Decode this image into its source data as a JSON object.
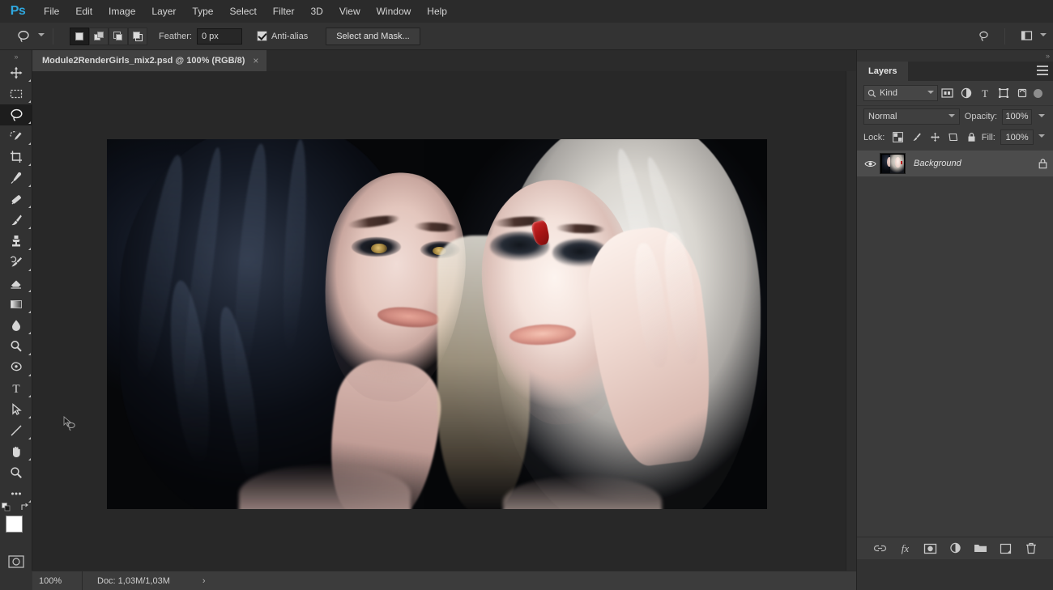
{
  "app": {
    "name": "Photoshop",
    "logo_text": "Ps",
    "accent_color": "#2fa8e0"
  },
  "menubar": {
    "items": [
      {
        "label": "File"
      },
      {
        "label": "Edit"
      },
      {
        "label": "Image"
      },
      {
        "label": "Layer"
      },
      {
        "label": "Type"
      },
      {
        "label": "Select"
      },
      {
        "label": "Filter"
      },
      {
        "label": "3D"
      },
      {
        "label": "View"
      },
      {
        "label": "Window"
      },
      {
        "label": "Help"
      }
    ]
  },
  "options_bar": {
    "active_tool": "lasso-tool",
    "selection_modes": [
      {
        "name": "new-selection",
        "active": true
      },
      {
        "name": "add-to-selection",
        "active": false
      },
      {
        "name": "subtract-from-selection",
        "active": false
      },
      {
        "name": "intersect-with-selection",
        "active": false
      }
    ],
    "feather_label": "Feather:",
    "feather_value": "0 px",
    "antialias_label": "Anti-alias",
    "antialias_checked": true,
    "select_and_mask_label": "Select and Mask...",
    "right_icons": [
      "search-icon",
      "workspace-switcher-icon"
    ]
  },
  "toolbar": {
    "collapse_label": "»",
    "tools": [
      {
        "name": "move-tool",
        "active": false,
        "has_flyout": true
      },
      {
        "name": "rectangular-marquee-tool",
        "active": false,
        "has_flyout": true
      },
      {
        "name": "lasso-tool",
        "active": true,
        "has_flyout": true
      },
      {
        "name": "quick-selection-tool",
        "active": false,
        "has_flyout": true
      },
      {
        "name": "crop-tool",
        "active": false,
        "has_flyout": true
      },
      {
        "name": "eyedropper-tool",
        "active": false,
        "has_flyout": true
      },
      {
        "name": "spot-healing-brush-tool",
        "active": false,
        "has_flyout": true
      },
      {
        "name": "brush-tool",
        "active": false,
        "has_flyout": true
      },
      {
        "name": "clone-stamp-tool",
        "active": false,
        "has_flyout": true
      },
      {
        "name": "history-brush-tool",
        "active": false,
        "has_flyout": true
      },
      {
        "name": "eraser-tool",
        "active": false,
        "has_flyout": true
      },
      {
        "name": "gradient-tool",
        "active": false,
        "has_flyout": true
      },
      {
        "name": "blur-tool",
        "active": false,
        "has_flyout": true
      },
      {
        "name": "dodge-tool",
        "active": false,
        "has_flyout": true
      },
      {
        "name": "pen-tool",
        "active": false,
        "has_flyout": true
      },
      {
        "name": "horizontal-type-tool",
        "active": false,
        "has_flyout": true
      },
      {
        "name": "path-selection-tool",
        "active": false,
        "has_flyout": true
      },
      {
        "name": "line-tool",
        "active": false,
        "has_flyout": true
      },
      {
        "name": "hand-tool",
        "active": false,
        "has_flyout": true
      },
      {
        "name": "zoom-tool",
        "active": false,
        "has_flyout": false
      },
      {
        "name": "edit-toolbar-tool",
        "active": false,
        "has_flyout": true
      }
    ],
    "foreground_color": "#ffffff",
    "background_color": "#000000",
    "quick_mask_name": "quick-mask-mode"
  },
  "document": {
    "tab_title": "Module2RenderGirls_mix2.psd @ 100% (RGB/8)",
    "close_label": "×",
    "canvas_background": "#282828",
    "artboard_background": "#000000"
  },
  "layers_panel": {
    "collapse_label": "»",
    "tabs": [
      {
        "label": "Layers",
        "active": true
      }
    ],
    "menu_icon": "panel-menu-icon",
    "filter": {
      "kind_label": "Kind",
      "search_icon": "search-icon",
      "type_icons": [
        "pixel-layer-filter-icon",
        "adjustment-layer-filter-icon",
        "type-layer-filter-icon",
        "shape-layer-filter-icon",
        "smart-object-filter-icon"
      ],
      "toggle_name": "filter-toggle"
    },
    "blend": {
      "mode": "Normal",
      "opacity_label": "Opacity:",
      "opacity_value": "100%"
    },
    "lock": {
      "label": "Lock:",
      "icons": [
        "lock-transparent-pixels-icon",
        "lock-image-pixels-icon",
        "lock-position-icon",
        "lock-artboard-nesting-icon",
        "lock-all-icon"
      ],
      "fill_label": "Fill:",
      "fill_value": "100%"
    },
    "layers": [
      {
        "name": "Background",
        "visible": true,
        "locked": true,
        "selected": true,
        "thumbnail": "two-women-portrait-thumbnail"
      }
    ],
    "footer_icons": [
      "link-layers-icon",
      "add-layer-style-icon",
      "add-layer-mask-icon",
      "new-adjustment-layer-icon",
      "new-group-icon",
      "new-layer-icon",
      "delete-layer-icon"
    ]
  },
  "status_bar": {
    "zoom_level": "100%",
    "doc_info": "Doc: 1,03M/1,03M",
    "expand_arrow": "›"
  },
  "canvas_image": {
    "description": "Two women portrait - dark haired woman left, blonde woman right with red nail polish",
    "nail_color": "#b01414"
  }
}
